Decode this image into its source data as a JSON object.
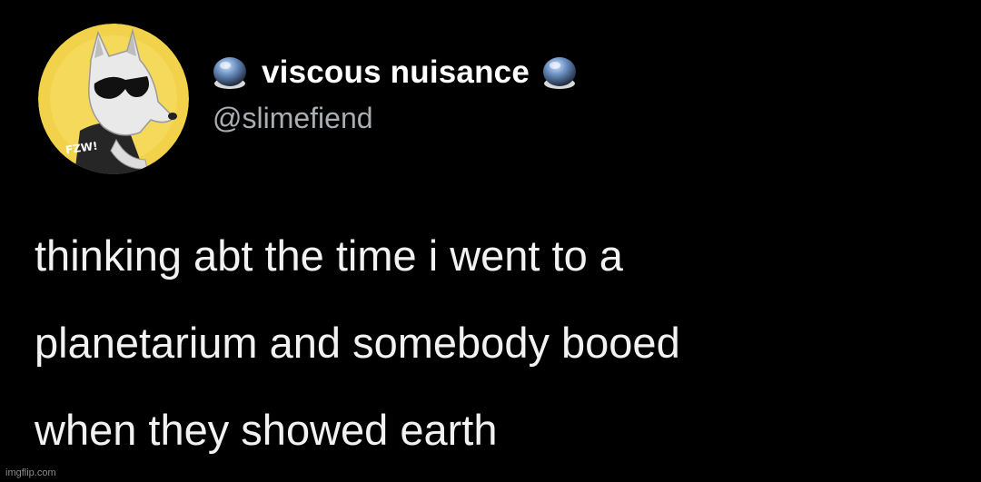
{
  "author": {
    "display_name": "viscous nuisance",
    "handle": "@slimefiend",
    "avatar_icon": "wolf-avatar-icon",
    "avatar_shirt_text": "FZW!",
    "badge_icon": "glowing-orb-icon"
  },
  "tweet": {
    "lines": [
      "thinking abt the time i went to a",
      "planetarium and somebody booed",
      "when they showed earth"
    ]
  },
  "watermark": "imgflip.com",
  "colors": {
    "background": "#000000",
    "name": "#ffffff",
    "handle": "#a9aeb3",
    "text": "#f2f2f2",
    "avatar_bg": "#f2d24a"
  }
}
